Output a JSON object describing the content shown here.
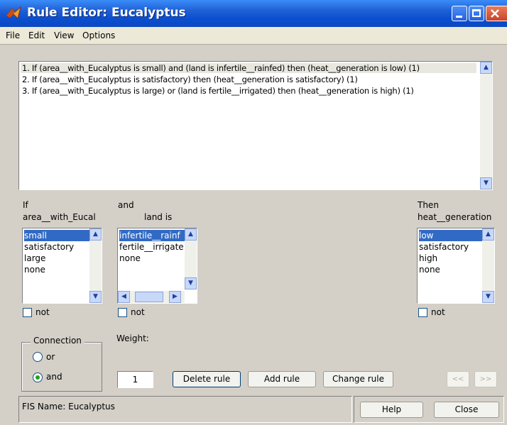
{
  "window": {
    "title": "Rule Editor: Eucalyptus"
  },
  "menu": [
    "File",
    "Edit",
    "View",
    "Options"
  ],
  "rules": [
    "1. If (area__with_Eucalyptus is small) and (land is infertile__rainfed) then (heat__generation is low) (1)",
    "2. If (area__with_Eucalyptus is satisfactory) then (heat__generation is satisfactory) (1)",
    "3. If (area__with_Eucalyptus is large) or (land is fertile__irrigated) then (heat__generation is high) (1)"
  ],
  "if_col": {
    "header1": "If",
    "header2": "area__with_Eucal",
    "items": [
      "small",
      "satisfactory",
      "large",
      "none"
    ],
    "selected": "small",
    "not_label": "not"
  },
  "and_col": {
    "header1": "and",
    "header2": "land is",
    "items": [
      "infertile__rainf",
      "fertile__irrigate",
      "none"
    ],
    "selected": "infertile__rainf",
    "not_label": "not"
  },
  "then_col": {
    "header1": "Then",
    "header2": "heat__generation",
    "items": [
      "low",
      "satisfactory",
      "high",
      "none"
    ],
    "selected": "low",
    "not_label": "not"
  },
  "connection": {
    "title": "Connection",
    "or_label": "or",
    "and_label": "and",
    "selected": "and"
  },
  "weight": {
    "label": "Weight:",
    "value": "1"
  },
  "buttons": {
    "delete_rule": "Delete rule",
    "add_rule": "Add rule",
    "change_rule": "Change rule",
    "prev": "<<",
    "next": ">>",
    "help": "Help",
    "close": "Close"
  },
  "status": {
    "fis_name": "FIS Name: Eucalyptus"
  },
  "colors": {
    "title_bar": "#0a4ed0",
    "selection": "#316ac5",
    "background": "#d4d0c8"
  }
}
